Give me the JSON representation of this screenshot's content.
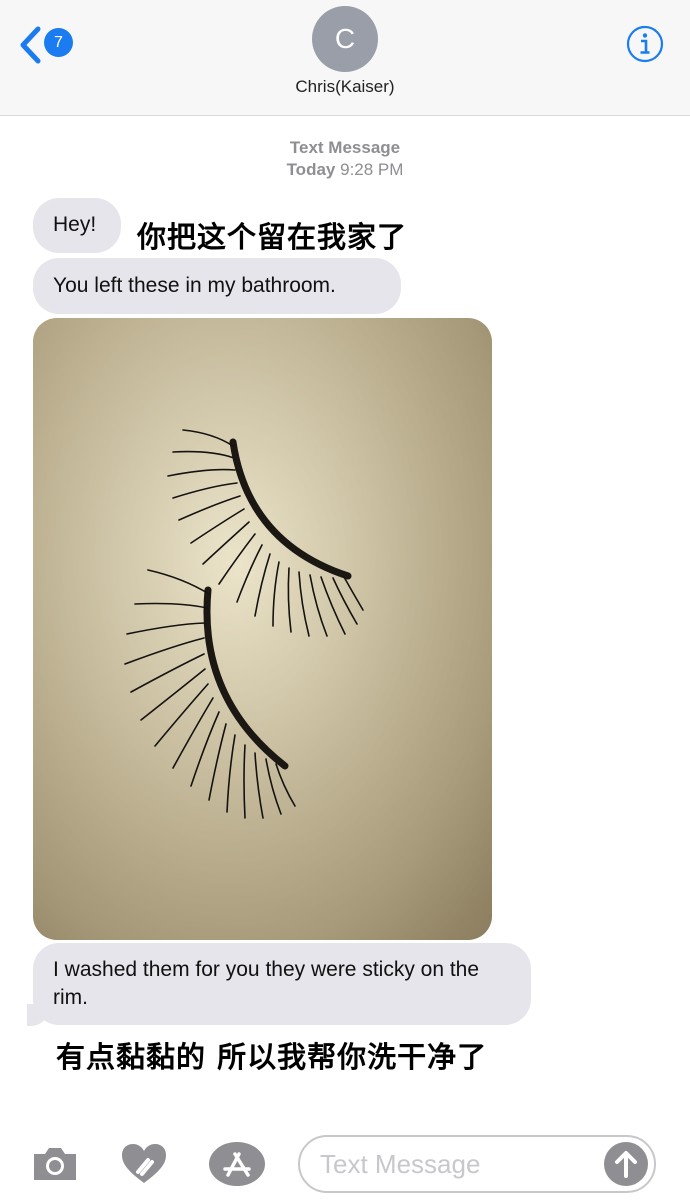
{
  "header": {
    "back_badge": "7",
    "avatar_initial": "C",
    "contact_name": "Chris(Kaiser)"
  },
  "conversation": {
    "label": "Text Message",
    "day": "Today",
    "time": "9:28 PM",
    "messages": [
      {
        "type": "text",
        "text": "Hey!"
      },
      {
        "type": "text",
        "text": "You left these in my bathroom."
      },
      {
        "type": "image",
        "subject": "false eyelashes photo"
      },
      {
        "type": "text",
        "text": "I washed them for you they were sticky on the rim."
      }
    ]
  },
  "captions": {
    "top": "你把这个留在我家了",
    "bottom": "有点黏黏的 所以我帮你洗干净了"
  },
  "composer": {
    "placeholder": "Text Message"
  },
  "icons": [
    "chevron-left-icon",
    "info-icon",
    "camera-icon",
    "digital-touch-icon",
    "app-store-icon",
    "send-arrow-icon"
  ],
  "colors": {
    "accent": "#1a7cf0",
    "bubble": "#e6e5eb",
    "avatar": "#9a9ea8"
  }
}
